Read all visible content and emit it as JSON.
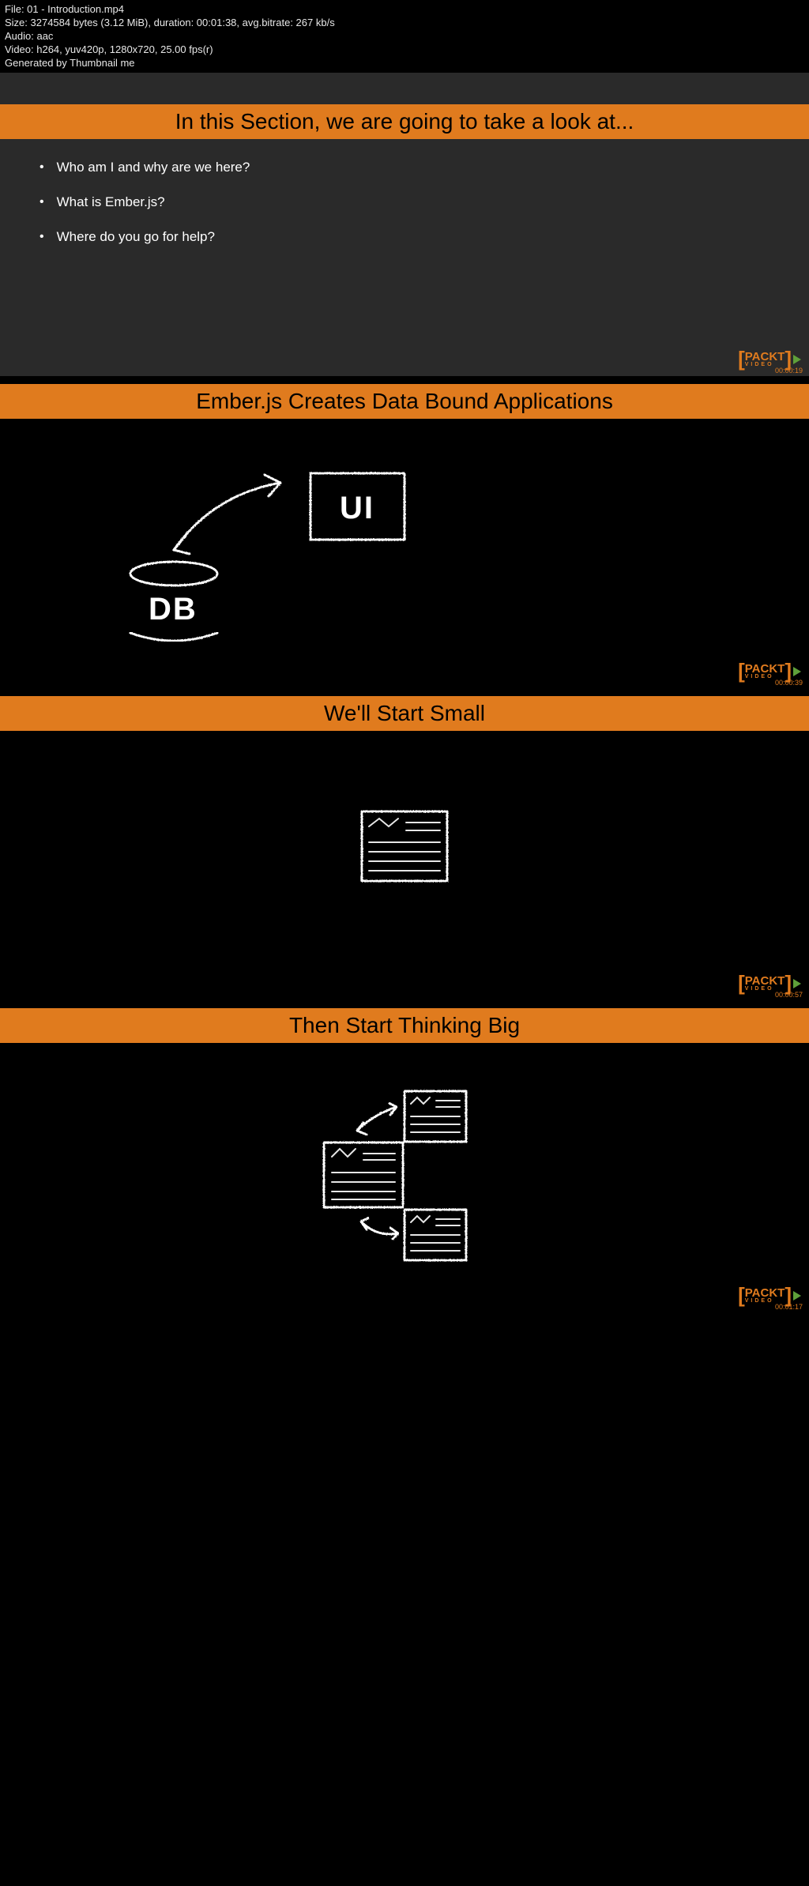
{
  "metadata": {
    "file": "File: 01 - Introduction.mp4",
    "size": "Size: 3274584 bytes (3.12 MiB), duration: 00:01:38, avg.bitrate: 267 kb/s",
    "audio": "Audio: aac",
    "video": "Video: h264, yuv420p, 1280x720, 25.00 fps(r)",
    "generated": "Generated by Thumbnail me"
  },
  "frames": [
    {
      "title": "In this Section, we are going to take a look at...",
      "bullets": [
        "Who am I and why are we here?",
        "What is Ember.js?",
        "Where do you go for help?"
      ],
      "timestamp": "00:00:19"
    },
    {
      "title": "Ember.js Creates Data Bound Applications",
      "db_label": "DB",
      "ui_label": "UI",
      "timestamp": "00:00:39"
    },
    {
      "title": "We'll Start Small",
      "timestamp": "00:00:57"
    },
    {
      "title": "Then Start Thinking Big",
      "timestamp": "00:01:17"
    }
  ],
  "watermark": {
    "brand": "PACKT",
    "sub": "VIDEO"
  }
}
